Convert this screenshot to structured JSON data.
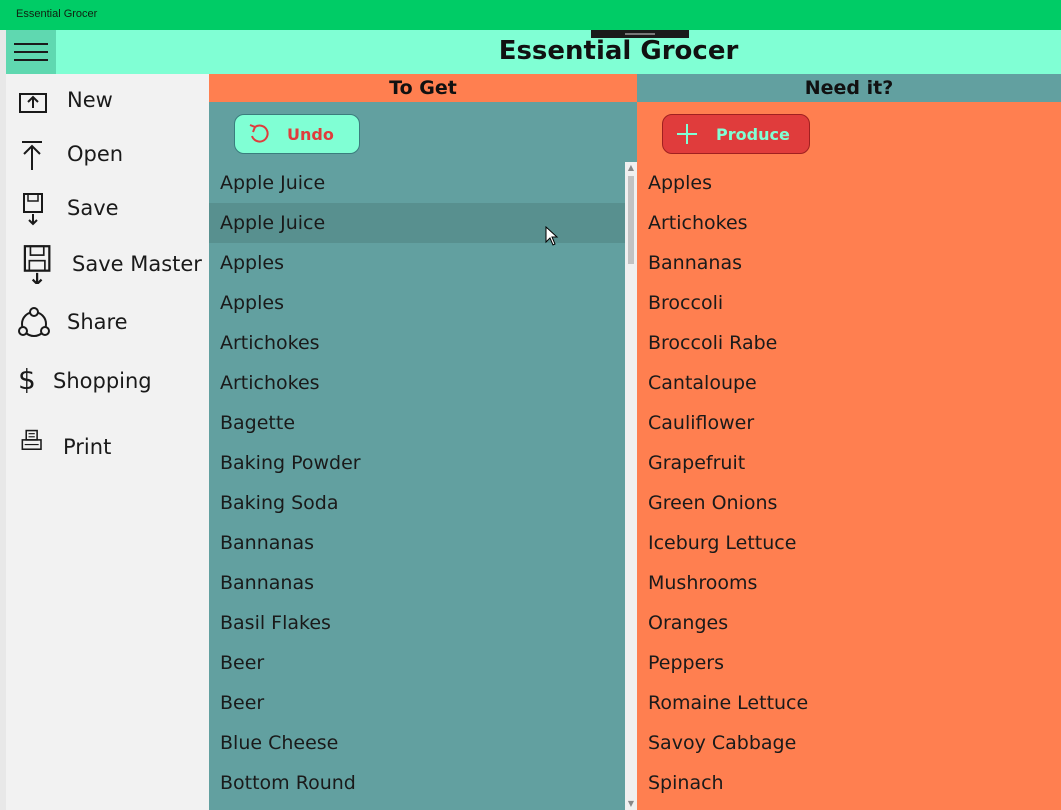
{
  "window": {
    "title": "Essential Grocer"
  },
  "header": {
    "app_title": "Essential Grocer"
  },
  "sidebar": {
    "items": [
      {
        "label": "New",
        "icon": "new-icon"
      },
      {
        "label": "Open",
        "icon": "open-icon"
      },
      {
        "label": "Save",
        "icon": "save-icon"
      },
      {
        "label": "Save Master",
        "icon": "save-master-icon"
      },
      {
        "label": "Share",
        "icon": "share-icon"
      },
      {
        "label": "Shopping",
        "icon": "dollar-icon"
      },
      {
        "label": "Print",
        "icon": "print-icon"
      }
    ]
  },
  "to_get": {
    "header": "To Get",
    "undo_label": "Undo",
    "items": [
      "Apple Juice",
      "Apple Juice",
      "Apples",
      "Apples",
      "Artichokes",
      "Artichokes",
      "Bagette",
      "Baking Powder",
      "Baking Soda",
      "Bannanas",
      "Bannanas",
      "Basil Flakes",
      "Beer",
      "Beer",
      "Blue Cheese",
      "Bottom Round"
    ]
  },
  "need_it": {
    "header": "Need it?",
    "category_label": "Produce",
    "items": [
      "Apples",
      "Artichokes",
      "Bannanas",
      "Broccoli",
      "Broccoli Rabe",
      "Cantaloupe",
      "Cauliflower",
      "Grapefruit",
      "Green Onions",
      "Iceburg Lettuce",
      "Mushrooms",
      "Oranges",
      "Peppers",
      "Romaine Lettuce",
      "Savoy Cabbage",
      "Spinach"
    ]
  },
  "colors": {
    "titlebar": "#00cc66",
    "header_bg": "#80ffd4",
    "teal": "#62a0a0",
    "coral": "#ff7f50",
    "red": "#e03c3c"
  }
}
